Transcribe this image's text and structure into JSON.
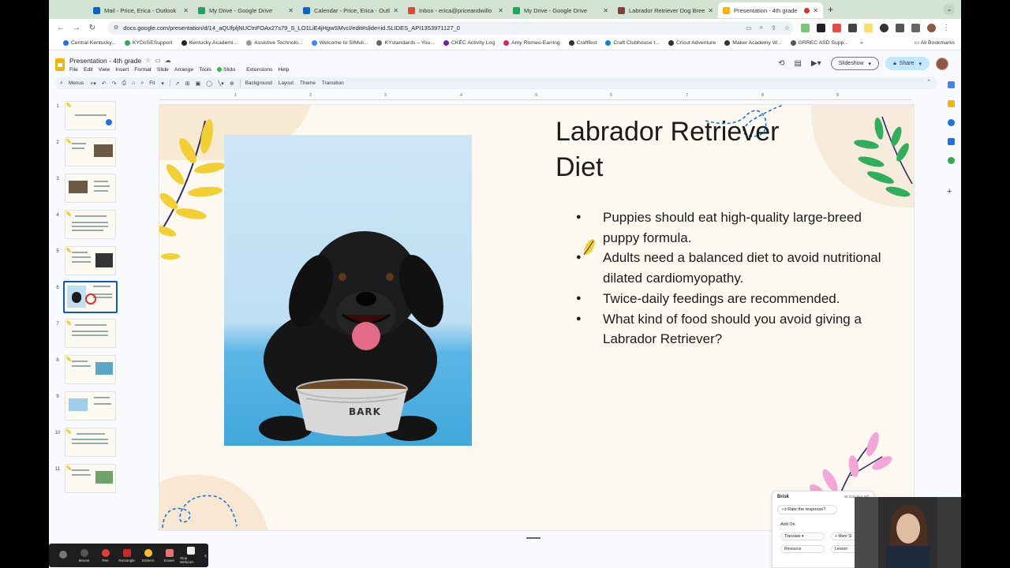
{
  "browser": {
    "tabs": [
      {
        "title": "Mail - Price, Erica - Outlook",
        "color": "#0a66c2"
      },
      {
        "title": "My Drive - Google Drive",
        "color": "#1fa463"
      },
      {
        "title": "Calendar - Price, Erica - Outl",
        "color": "#0a66c2"
      },
      {
        "title": "Inbox - erica@priceandwillo",
        "color": "#ea4335"
      },
      {
        "title": "My Drive - Google Drive",
        "color": "#1fa463"
      },
      {
        "title": "Labrador Retriever Dog Bree",
        "color": "#8b3a3a"
      },
      {
        "title": "Presentation - 4th grade",
        "color": "#f4b400"
      }
    ],
    "url": "docs.google.com/presentation/d/14_aQUfpljNUCtnFOAx27s79_S_LO1LiE4jHgwSMvcI/edit#slide=id.SLIDES_API1353971127_0",
    "bookmarks": [
      {
        "label": "Central Kentucky...",
        "color": "#1a73e8"
      },
      {
        "label": "KYDoSESupport",
        "color": "#34a853"
      },
      {
        "label": "Kentucky Academi...",
        "color": "#222"
      },
      {
        "label": "Assistive Technolo...",
        "color": "#999"
      },
      {
        "label": "Welcome to SIMvil...",
        "color": "#4285f4"
      },
      {
        "label": "KYstandards – You...",
        "color": "#666"
      },
      {
        "label": "CKEC Activity Log",
        "color": "#7b1fa2"
      },
      {
        "label": "Amy Romeu-Earring",
        "color": "#e91e63"
      },
      {
        "label": "Craftfest",
        "color": "#333"
      },
      {
        "label": "Craft Clubhouse t...",
        "color": "#0288d1"
      },
      {
        "label": "Cricut Adventure",
        "color": "#333"
      },
      {
        "label": "Maker Academy W...",
        "color": "#333"
      },
      {
        "label": "GRREC ASD Supp...",
        "color": "#555"
      }
    ],
    "all_bookmarks": "All Bookmarks"
  },
  "doc": {
    "title": "Presentation - 4th grade",
    "menus": [
      "File",
      "Edit",
      "View",
      "Insert",
      "Format",
      "Slide",
      "Arrange",
      "Tools",
      "Slido",
      "Extensions",
      "Help"
    ],
    "slideshow_label": "Slideshow",
    "share_label": "Share"
  },
  "toolbar": {
    "menus_label": "Menus",
    "zoom_label": "Fit",
    "background": "Background",
    "layout": "Layout",
    "theme": "Theme",
    "transition": "Transition"
  },
  "ruler_ticks": [
    "1",
    "2",
    "3",
    "4",
    "5",
    "6",
    "7",
    "8",
    "9"
  ],
  "filmstrip": {
    "numbers": [
      "1",
      "2",
      "3",
      "4",
      "5",
      "6",
      "7",
      "8",
      "9",
      "10",
      "11"
    ],
    "selected": 6
  },
  "slide": {
    "title": "Labrador Retriever Diet",
    "bullets": [
      "Puppies should eat high-quality large-breed puppy formula.",
      "Adults need a balanced diet to avoid nutritional dilated cardiomyopathy.",
      "Twice-daily feedings are recommended.",
      "What kind of food should you avoid giving a Labrador Retriever?"
    ],
    "bowl_label": "BARK"
  },
  "brisk": {
    "title": "Brisk",
    "trial": "45 trial days left",
    "rate": "Rate the response?",
    "addon": "Add On",
    "translate": "Translate",
    "more": "More Sl",
    "resource": "Resource",
    "lesson": "Lesson"
  },
  "recorder": {
    "items": [
      "Mouse",
      "Pen",
      "Rectangle",
      "Stickers",
      "Eraser",
      "Stop Webcam"
    ]
  },
  "colors": {
    "accent": "#0b57d0",
    "slide_bg": "#fdf9f0",
    "leaf_yellow": "#f2cf33",
    "leaf_green": "#2fae5b",
    "leaf_pink": "#f4a6d7"
  }
}
